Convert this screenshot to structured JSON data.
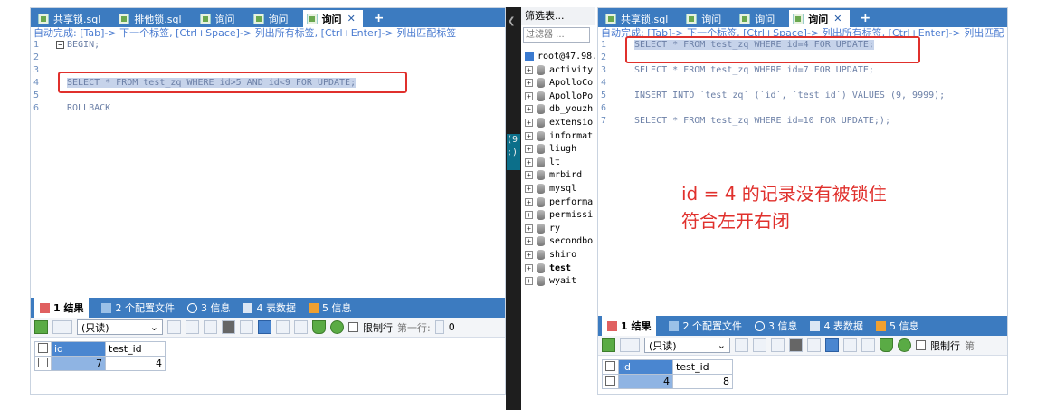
{
  "left": {
    "tabs": [
      "共享锁.sql",
      "排他锁.sql",
      "询问",
      "询问",
      "询问"
    ],
    "active_tab": 4,
    "autocomplete_hint": "自动完成: [Tab]-> 下一个标签, [Ctrl+Space]-> 列出所有标签, [Ctrl+Enter]-> 列出匹配标签",
    "lines": [
      "BEGIN;",
      "",
      "",
      "SELECT * FROM test_zq WHERE id>5 AND id<9 FOR UPDATE;",
      "",
      "ROLLBACK"
    ],
    "line_numbers": [
      "1",
      "2",
      "3",
      "4",
      "5",
      "6"
    ],
    "result_tabs": [
      "1 结果",
      "2 个配置文件",
      "3 信息",
      "4 表数据",
      "5 信息"
    ],
    "readonly_label": "(只读)",
    "limit_label": "限制行",
    "first_row_label": "第一行:",
    "first_row_value": "0",
    "columns": [
      "id",
      "test_id"
    ],
    "rows": [
      [
        "7",
        "4"
      ]
    ]
  },
  "middle": {
    "filter_title": "筛选表...",
    "filter_placeholder": "过滤器 ...",
    "root": "root@47.98.",
    "databases": [
      "activity",
      "ApolloCo",
      "ApolloPo",
      "db_youzh",
      "extensio",
      "informat",
      "liugh",
      "lt",
      "mrbird",
      "mysql",
      "performa",
      "permissi",
      "ry",
      "secondbo",
      "shiro",
      "test",
      "wyait"
    ],
    "selected_db": "test",
    "edge_text": "(9\n;)"
  },
  "right": {
    "tabs": [
      "共享锁.sql",
      "询问",
      "询问",
      "询问"
    ],
    "active_tab": 3,
    "autocomplete_hint": "自动完成: [Tab]-> 下一个标签, [Ctrl+Space]-> 列出所有标签, [Ctrl+Enter]-> 列出匹配",
    "lines": [
      "SELECT * FROM test_zq WHERE id=4 FOR UPDATE;",
      "",
      "SELECT * FROM test_zq WHERE id=7 FOR UPDATE;",
      "",
      "INSERT INTO `test_zq` (`id`, `test_id`) VALUES (9, 9999);",
      "",
      "SELECT * FROM test_zq WHERE id=10 FOR UPDATE;);"
    ],
    "line_numbers": [
      "1",
      "2",
      "3",
      "4",
      "5",
      "6",
      "7"
    ],
    "annotation": [
      "id = 4 的记录没有被锁住",
      "符合左开右闭"
    ],
    "result_tabs": [
      "1 结果",
      "2 个配置文件",
      "3 信息",
      "4 表数据",
      "5 信息"
    ],
    "readonly_label": "(只读)",
    "limit_label": "限制行",
    "first_row_label": "第",
    "columns": [
      "id",
      "test_id"
    ],
    "rows": [
      [
        "4",
        "8"
      ]
    ]
  },
  "colors": {
    "accent": "#3c7bc0",
    "annotation": "#e0302c",
    "selection": "#c6d3ea"
  }
}
